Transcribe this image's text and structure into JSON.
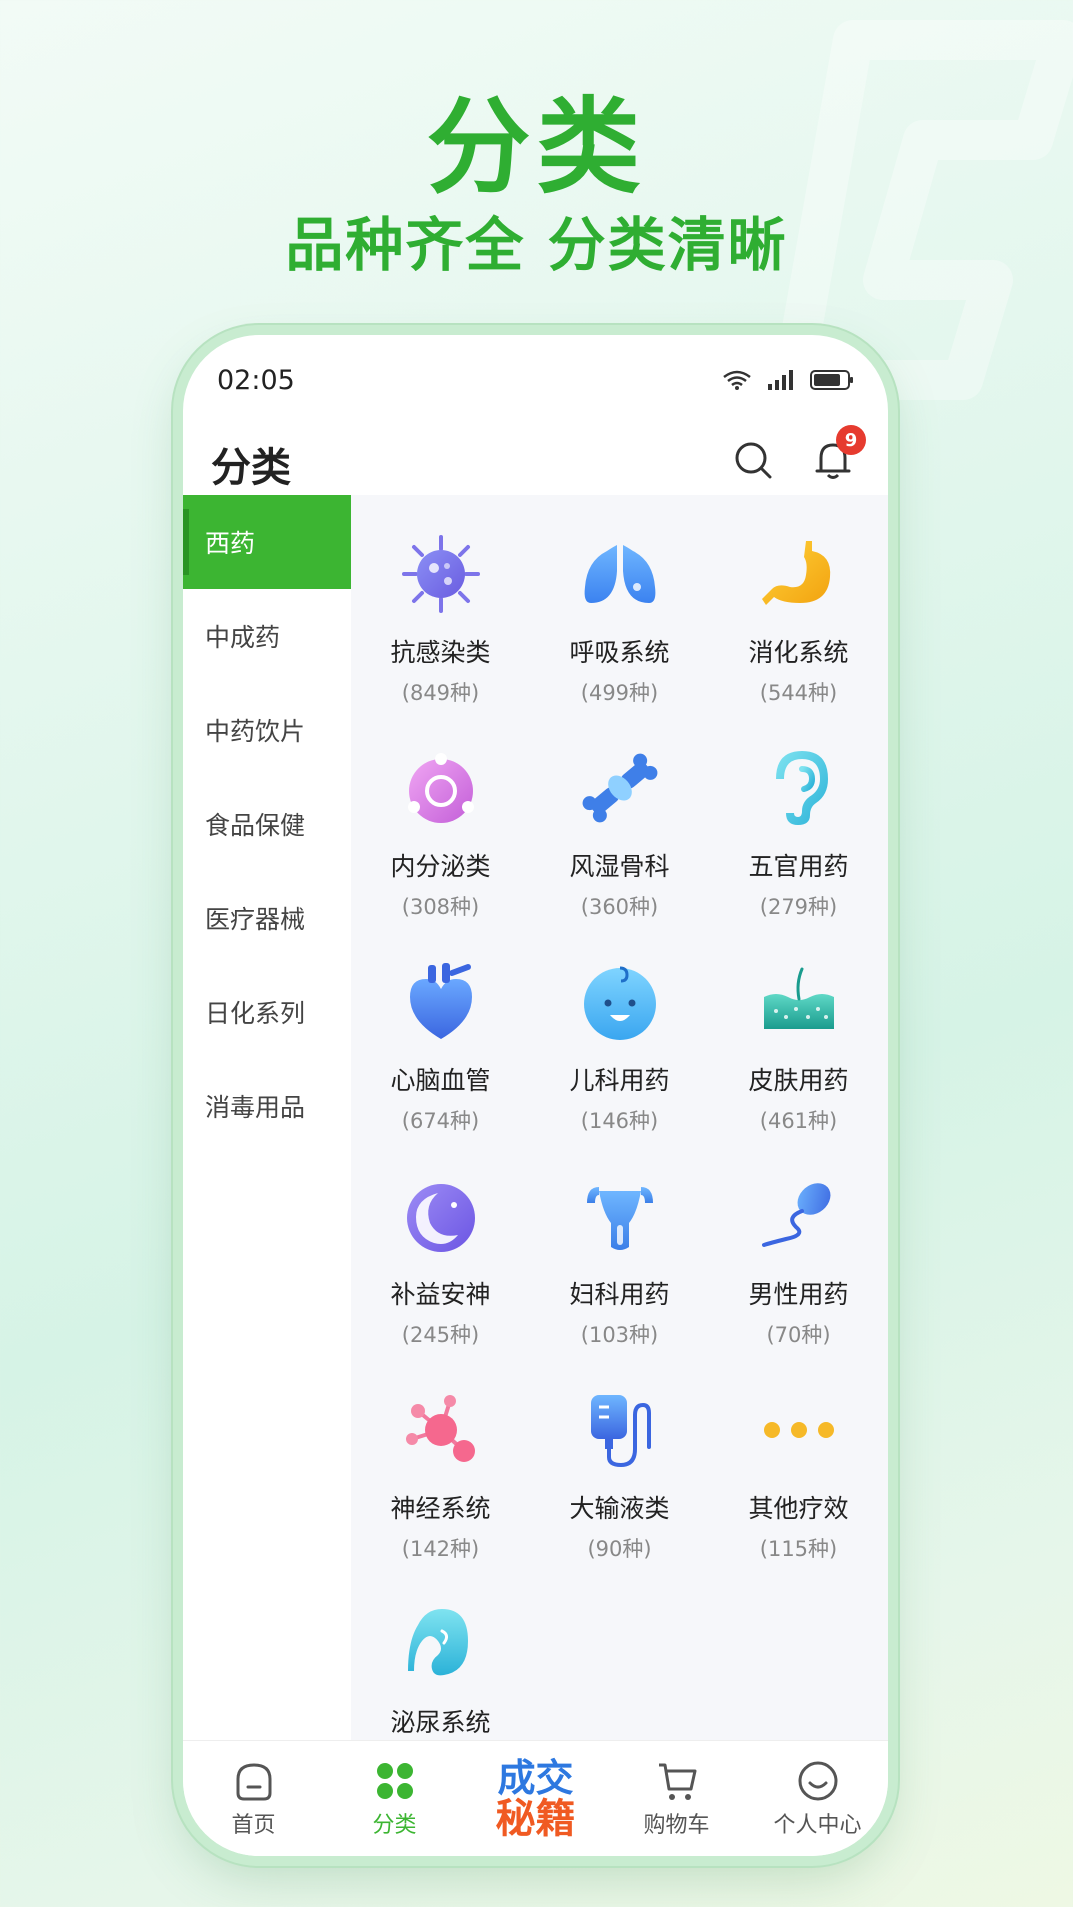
{
  "hero": {
    "title": "分类",
    "subtitle": "品种齐全 分类清晰"
  },
  "status_bar": {
    "time": "02:05"
  },
  "header": {
    "title": "分类",
    "notification_count": "9"
  },
  "sidebar": {
    "items": [
      {
        "label": "西药",
        "active": true
      },
      {
        "label": "中成药"
      },
      {
        "label": "中药饮片"
      },
      {
        "label": "食品保健"
      },
      {
        "label": "医疗器械"
      },
      {
        "label": "日化系列"
      },
      {
        "label": "消毒用品"
      }
    ]
  },
  "categories": [
    {
      "name": "抗感染类",
      "count": "(849种)",
      "icon": "virus-icon"
    },
    {
      "name": "呼吸系统",
      "count": "(499种)",
      "icon": "lungs-icon"
    },
    {
      "name": "消化系统",
      "count": "(544种)",
      "icon": "stomach-icon"
    },
    {
      "name": "内分泌类",
      "count": "(308种)",
      "icon": "endocrine-icon"
    },
    {
      "name": "风湿骨科",
      "count": "(360种)",
      "icon": "bone-joint-icon"
    },
    {
      "name": "五官用药",
      "count": "(279种)",
      "icon": "ear-icon"
    },
    {
      "name": "心脑血管",
      "count": "(674种)",
      "icon": "heart-icon"
    },
    {
      "name": "儿科用药",
      "count": "(146种)",
      "icon": "baby-icon"
    },
    {
      "name": "皮肤用药",
      "count": "(461种)",
      "icon": "skin-icon"
    },
    {
      "name": "补益安神",
      "count": "(245种)",
      "icon": "moon-icon"
    },
    {
      "name": "妇科用药",
      "count": "(103种)",
      "icon": "uterus-icon"
    },
    {
      "name": "男性用药",
      "count": "(70种)",
      "icon": "sperm-icon"
    },
    {
      "name": "神经系统",
      "count": "(142种)",
      "icon": "neuron-icon"
    },
    {
      "name": "大输液类",
      "count": "(90种)",
      "icon": "iv-drip-icon"
    },
    {
      "name": "其他疗效",
      "count": "(115种)",
      "icon": "more-dots-icon"
    },
    {
      "name": "泌尿系统",
      "count": "",
      "icon": "kidney-icon"
    }
  ],
  "tabbar": {
    "home": "首页",
    "category": "分类",
    "promo_line1": "成交",
    "promo_line2": "秘籍",
    "cart": "购物车",
    "profile": "个人中心"
  },
  "colors": {
    "brand_green": "#3cb532",
    "badge_red": "#e63b2f"
  }
}
